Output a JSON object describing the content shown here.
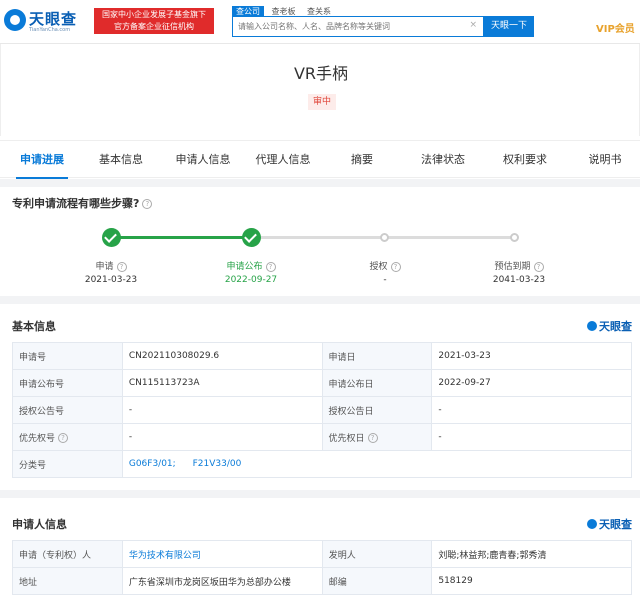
{
  "header": {
    "logo_text": "天眼查",
    "logo_sub": "TianYanCha.com",
    "banner_line1": "国家中小企业发展子基金旗下",
    "banner_line2": "官方备案企业征信机构",
    "search_tabs": [
      "查公司",
      "查老板",
      "查关系"
    ],
    "search_placeholder": "请输入公司名称、人名、品牌名称等关键词",
    "search_clear": "×",
    "search_button": "天眼一下",
    "vip": "VIP会员"
  },
  "patent": {
    "title": "VR手柄",
    "status": "审中"
  },
  "tabs": [
    "申请进展",
    "基本信息",
    "申请人信息",
    "代理人信息",
    "摘要",
    "法律状态",
    "权利要求",
    "说明书"
  ],
  "progress": {
    "title": "专利申请流程有哪些步骤?",
    "steps": [
      {
        "label": "申请",
        "date": "2021-03-23"
      },
      {
        "label": "申请公布",
        "date": "2022-09-27"
      },
      {
        "label": "授权",
        "date": "-"
      },
      {
        "label": "预估到期",
        "date": "2041-03-23"
      }
    ]
  },
  "brand": "天眼查",
  "basic": {
    "title": "基本信息",
    "rows": [
      {
        "k1": "申请号",
        "v1": "CN202110308029.6",
        "k2": "申请日",
        "v2": "2021-03-23"
      },
      {
        "k1": "申请公布号",
        "v1": "CN115113723A",
        "k2": "申请公布日",
        "v2": "2022-09-27"
      },
      {
        "k1": "授权公告号",
        "v1": "-",
        "k2": "授权公告日",
        "v2": "-"
      },
      {
        "k1": "优先权号",
        "v1": "-",
        "k2": "优先权日",
        "v2": "-"
      }
    ],
    "class_label": "分类号",
    "class_codes": [
      "G06F3/01;",
      "F21V33/00"
    ]
  },
  "applicant": {
    "title": "申请人信息",
    "rows": [
      {
        "k1": "申请（专利权）人",
        "v1": "华为技术有限公司",
        "k2": "发明人",
        "v2": "刘聪;林益邦;鹿青春;郭秀清"
      },
      {
        "k1": "地址",
        "v1": "广东省深圳市龙岗区坂田华为总部办公楼",
        "k2": "邮编",
        "v2": "518129"
      }
    ]
  }
}
